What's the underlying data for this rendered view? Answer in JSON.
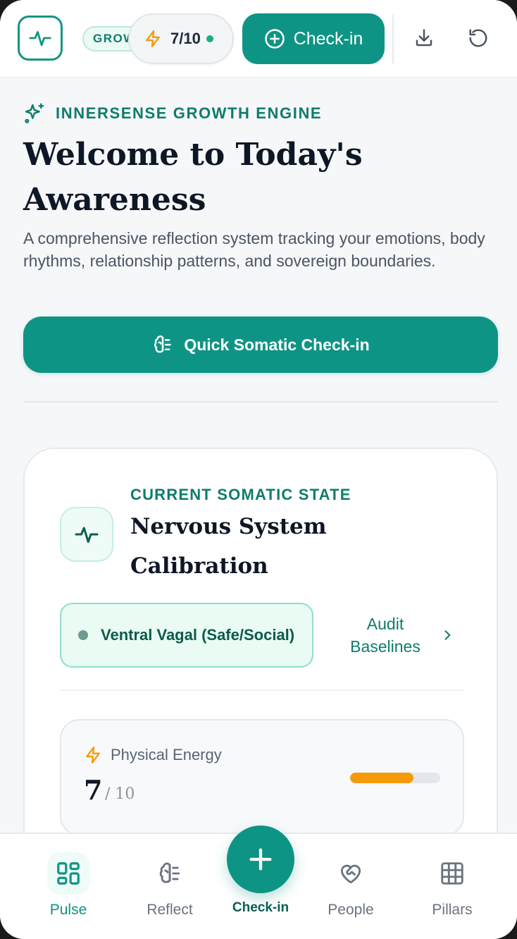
{
  "header": {
    "badge_label": "GROWTH",
    "energy_value": "7/10",
    "checkin_label": "Check-in"
  },
  "hero": {
    "eyebrow": "INNERSENSE GROWTH ENGINE",
    "title": "Welcome to Today's Awareness",
    "description": "A comprehensive reflection system tracking your emotions, body rhythms, relationship patterns, and sovereign boundaries.",
    "quick_button_label": "Quick Somatic Check-in"
  },
  "state_card": {
    "eyebrow": "CURRENT SOMATIC STATE",
    "title": "Nervous System Calibration",
    "state_label": "Ventral Vagal (Safe/Social)",
    "audit_label": "Audit Baselines",
    "energy": {
      "label": "Physical Energy",
      "value": "7",
      "denominator": "/ 10",
      "level_fraction": 0.7
    }
  },
  "bottom_nav": {
    "items": [
      {
        "label": "Pulse"
      },
      {
        "label": "Reflect"
      },
      {
        "label": "Check-in"
      },
      {
        "label": "People"
      },
      {
        "label": "Pillars"
      }
    ]
  },
  "colors": {
    "brand": "#0e9484",
    "accent_energy": "#f59b0b",
    "text_dark": "#0e1726"
  },
  "icons": {
    "logo": "pulse-icon",
    "energy": "lightning-icon",
    "download": "download-icon",
    "reset": "reset-icon"
  }
}
